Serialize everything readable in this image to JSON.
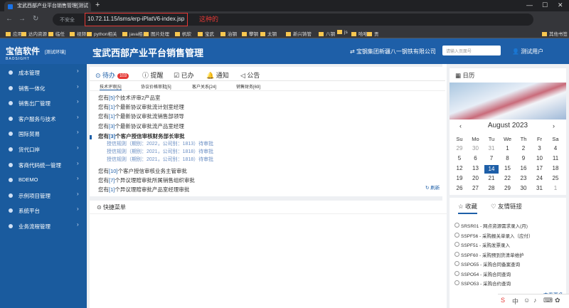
{
  "browser": {
    "tab_title": "宝武西部产业平台销售管理[测试",
    "insecure_label": "不安全",
    "url": "10.72.11.15/isms/erp-iPlatV6-index.jsp",
    "annotation": "这种的",
    "bookmarks": [
      "应用",
      "达内资源",
      "临任",
      "视频",
      "python相关",
      "java相关",
      "图片处理",
      "帆软",
      "宝武",
      "治钢",
      "攀钢",
      "太钢",
      "新兴铸管",
      "八钢",
      "js",
      "哈哈",
      "贡",
      "其他书签"
    ]
  },
  "header": {
    "logo": "宝信软件",
    "logo_sub": "BAOSIGHT",
    "env": "[测试环境]",
    "title": "宝武西部产业平台销售管理",
    "company": "宝钢集团新疆八一钢铁有限公司",
    "search_placeholder": "请输入页面号",
    "user": "测试用户"
  },
  "sidebar": {
    "items": [
      {
        "label": "成本管理"
      },
      {
        "label": "销售一体化"
      },
      {
        "label": "销售出厂管理"
      },
      {
        "label": "客户服务与技术"
      },
      {
        "label": "国际贸易"
      },
      {
        "label": "货代口岸"
      },
      {
        "label": "客商代码统一管理"
      },
      {
        "label": "BDEMO"
      },
      {
        "label": "示例项目管理"
      },
      {
        "label": "系统平台"
      },
      {
        "label": "业务流程管理"
      }
    ]
  },
  "main": {
    "tabs": {
      "todo": "待办",
      "todo_count": "103",
      "remind": "提醒",
      "done": "已办",
      "notice": "通知",
      "announce": "公告"
    },
    "subtabs": [
      "技术评审[5]",
      "协议价格审批[5]",
      "客户关系[24]",
      "销售财务[69]"
    ],
    "rows": [
      {
        "pre": "您有",
        "n": "[5]",
        "post": "个技术评审2产品室"
      },
      {
        "pre": "您有",
        "n": "[1]",
        "post": "个最新协议审批流计划室经理"
      },
      {
        "pre": "您有",
        "n": "[1]",
        "post": "个最新协议审批流销售部领导"
      },
      {
        "pre": "您有",
        "n": "[3]",
        "post": "个最新协议审批流产品室经理"
      },
      {
        "pre": "您有",
        "n": "[3]",
        "post": "个客户授信审核财务部长审批"
      }
    ],
    "subrows": [
      "授信规则（期别：2022，公司别：1813）待审批",
      "授信规则（期别：2021，公司别：1818）待审批",
      "授信规则（期别：2021，公司别：1818）待审批"
    ],
    "rows2": [
      {
        "pre": "您有",
        "n": "[10]",
        "post": "个客户授信审核业务主管审批"
      },
      {
        "pre": "您有",
        "n": "[7]",
        "post": "个异议理赔审批所属销售组织审批"
      },
      {
        "pre": "您有",
        "n": "[1]",
        "post": "个异议理赔审批产品室经理审批"
      }
    ],
    "refresh": "刷新",
    "quick_menu": "快捷菜单"
  },
  "calendar": {
    "title": "日历",
    "month": "August 2023",
    "dow": [
      "Su",
      "Mo",
      "Tu",
      "We",
      "Th",
      "Fr",
      "Sa"
    ],
    "weeks": [
      [
        "29",
        "30",
        "31",
        "1",
        "2",
        "3",
        "4"
      ],
      [
        "5",
        "6",
        "7",
        "8",
        "9",
        "10",
        "11"
      ],
      [
        "12",
        "13",
        "14",
        "15",
        "16",
        "17",
        "18"
      ],
      [
        "19",
        "20",
        "21",
        "22",
        "23",
        "24",
        "25"
      ],
      [
        "26",
        "27",
        "28",
        "29",
        "30",
        "31",
        "1"
      ]
    ],
    "today": "14"
  },
  "favorites": {
    "tab1": "收藏",
    "tab2": "友情链接",
    "items": [
      "SRSR01 - 网点资源需求录入(月)",
      "SSPF56 - 采购报关单录入（应付）",
      "SSPF51 - 采购发票录入",
      "SSPF60 - 采购预到货清单维护",
      "SSPO55 - 采购合同备案查询",
      "SSPO54 - 采购合同查询",
      "SSPO53 - 采购合约查询"
    ],
    "more": "» 查看更多"
  }
}
